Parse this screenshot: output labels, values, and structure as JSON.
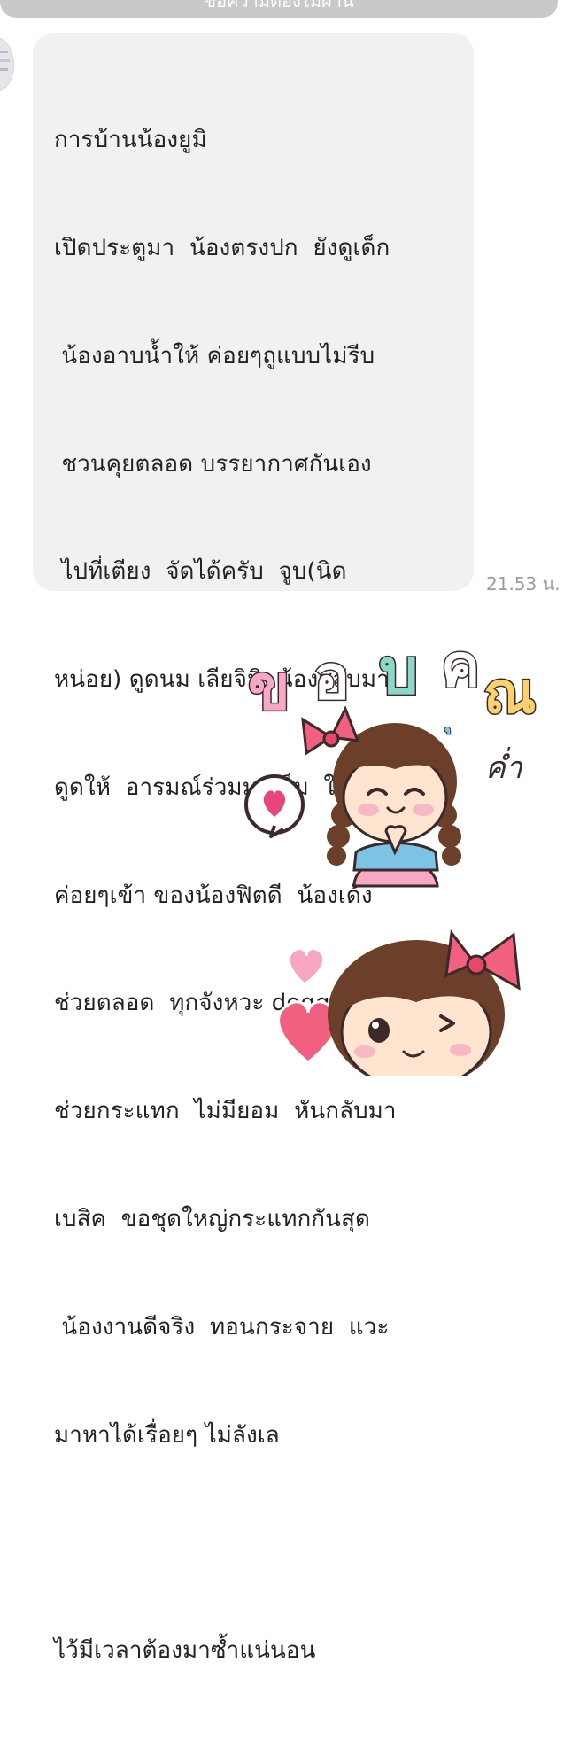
{
  "header": {
    "banner_text": "ข้อความต้องไม่ผ่าน"
  },
  "message": {
    "lines": [
      "การบ้านน้องยูมิ",
      "เปิดประตูมา  น้องตรงปก  ยังดูเด็ก",
      " น้องอาบน้ำให้ ค่อยๆถูแบบไม่รีบ",
      " ชวนคุยตลอด บรรยากาศกันเอง",
      " ไปที่เตียง  จัดได้ครับ  จูบ(นิด",
      "หน่อย) ดูดนม เลียจิมิ  น้องสลับมา",
      "ดูดให้  อารมณ์ร่วมมาเต็ม  ใส่ถุง",
      "ค่อยๆเข้า ของน้องฟิตดี  น้องเด้ง",
      "ช่วยตลอด  ทุกจังหวะ doggy ก็",
      "ช่วยกระแทก  ไม่มียอม  หันกลับมา",
      "เบสิค  ขอชุดใหญ่กระแทกกันสุด",
      " น้องงานดีจริง  ทอนกระจาย  แวะ",
      "มาหาได้เรื่อยๆ ไม่ลังเล",
      "",
      "ไว้มีเวลาต้องมาซ้ำแน่นอน"
    ],
    "time": "21.53 น."
  },
  "stickers": [
    {
      "name": "thank-you-girl-sticker",
      "text": "ขอบคุณ",
      "subtext": "ค่ำ"
    },
    {
      "name": "winking-girl-sticker"
    }
  ],
  "colors": {
    "bubble": "#eff1f3",
    "text": "#222222",
    "timestamp": "#9a9a9a",
    "banner": "#c9c9c9"
  }
}
